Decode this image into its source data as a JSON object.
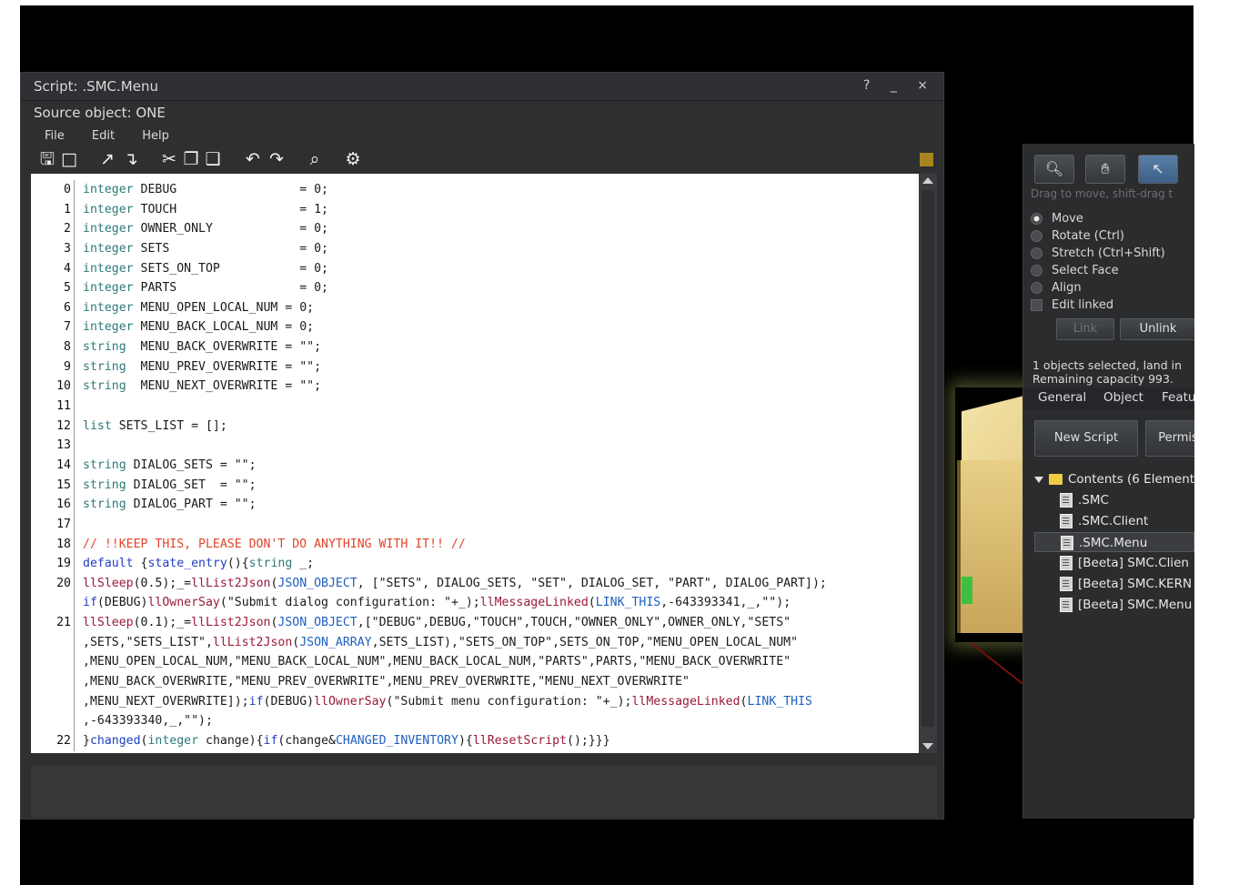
{
  "script_window": {
    "title": "Script: .SMC.Menu",
    "controls": "? _ ×",
    "source_object": "Source object: ONE",
    "menu": [
      "File",
      "Edit",
      "Help"
    ],
    "toolbar_icons": [
      "save-icon",
      "save-as-icon",
      "load-icon",
      "save-to-disk-icon",
      "cut-icon",
      "copy-icon",
      "paste-icon",
      "undo-icon",
      "redo-icon",
      "find-icon",
      "settings-icon"
    ]
  },
  "code_lines": [
    {
      "n": "0",
      "segs": [
        [
          "integer",
          "type"
        ],
        [
          " DEBUG                 = 0;",
          ""
        ]
      ]
    },
    {
      "n": "1",
      "segs": [
        [
          "integer",
          "type"
        ],
        [
          " TOUCH                 = 1;",
          ""
        ]
      ]
    },
    {
      "n": "2",
      "segs": [
        [
          "integer",
          "type"
        ],
        [
          " OWNER_ONLY            = 0;",
          ""
        ]
      ]
    },
    {
      "n": "3",
      "segs": [
        [
          "integer",
          "type"
        ],
        [
          " SETS                  = 0;",
          ""
        ]
      ]
    },
    {
      "n": "4",
      "segs": [
        [
          "integer",
          "type"
        ],
        [
          " SETS_ON_TOP           = 0;",
          ""
        ]
      ]
    },
    {
      "n": "5",
      "segs": [
        [
          "integer",
          "type"
        ],
        [
          " PARTS                 = 0;",
          ""
        ]
      ]
    },
    {
      "n": "6",
      "segs": [
        [
          "integer",
          "type"
        ],
        [
          " MENU_OPEN_LOCAL_NUM = 0;",
          ""
        ]
      ]
    },
    {
      "n": "7",
      "segs": [
        [
          "integer",
          "type"
        ],
        [
          " MENU_BACK_LOCAL_NUM = 0;",
          ""
        ]
      ]
    },
    {
      "n": "8",
      "segs": [
        [
          "string",
          "type"
        ],
        [
          "  MENU_BACK_OVERWRITE = \"\";",
          ""
        ]
      ]
    },
    {
      "n": "9",
      "segs": [
        [
          "string",
          "type"
        ],
        [
          "  MENU_PREV_OVERWRITE = \"\";",
          ""
        ]
      ]
    },
    {
      "n": "10",
      "segs": [
        [
          "string",
          "type"
        ],
        [
          "  MENU_NEXT_OVERWRITE = \"\";",
          ""
        ]
      ]
    },
    {
      "n": "11",
      "segs": []
    },
    {
      "n": "12",
      "segs": [
        [
          "list",
          "type"
        ],
        [
          " SETS_LIST = [];",
          ""
        ]
      ]
    },
    {
      "n": "13",
      "segs": []
    },
    {
      "n": "14",
      "segs": [
        [
          "string",
          "type"
        ],
        [
          " DIALOG_SETS = \"\";",
          ""
        ]
      ]
    },
    {
      "n": "15",
      "segs": [
        [
          "string",
          "type"
        ],
        [
          " DIALOG_SET  = \"\";",
          ""
        ]
      ]
    },
    {
      "n": "16",
      "segs": [
        [
          "string",
          "type"
        ],
        [
          " DIALOG_PART = \"\";",
          ""
        ]
      ]
    },
    {
      "n": "17",
      "segs": []
    },
    {
      "n": "18",
      "segs": [
        [
          "// !!KEEP THIS, PLEASE DON'T DO ANYTHING WITH IT!! //",
          "cmt"
        ]
      ]
    },
    {
      "n": "19",
      "segs": [
        [
          "default",
          "kw"
        ],
        [
          " {",
          ""
        ],
        [
          "state_entry",
          "kw"
        ],
        [
          "(){",
          ""
        ],
        [
          "string",
          "type"
        ],
        [
          " _;",
          ""
        ]
      ]
    },
    {
      "n": "20",
      "segs": [
        [
          "llSleep",
          "fn"
        ],
        [
          "(0.5);_=",
          ""
        ],
        [
          "llList2Json",
          "fn"
        ],
        [
          "(",
          ""
        ],
        [
          "JSON_OBJECT",
          "const"
        ],
        [
          ", [\"SETS\", DIALOG_SETS, \"SET\", DIALOG_SET, \"PART\", DIALOG_PART]);",
          ""
        ]
      ]
    },
    {
      "n": "",
      "segs": [
        [
          "if",
          "kw"
        ],
        [
          "(DEBUG)",
          ""
        ],
        [
          "llOwnerSay",
          "fn"
        ],
        [
          "(\"Submit dialog configuration: \"+_);",
          ""
        ],
        [
          "llMessageLinked",
          "fn"
        ],
        [
          "(",
          ""
        ],
        [
          "LINK_THIS",
          "const"
        ],
        [
          ",-643393341,_,\"\");",
          ""
        ]
      ]
    },
    {
      "n": "21",
      "segs": [
        [
          "llSleep",
          "fn"
        ],
        [
          "(0.1);_=",
          ""
        ],
        [
          "llList2Json",
          "fn"
        ],
        [
          "(",
          ""
        ],
        [
          "JSON_OBJECT",
          "const"
        ],
        [
          ",[\"DEBUG\",DEBUG,\"TOUCH\",TOUCH,\"OWNER_ONLY\",OWNER_ONLY,\"SETS\"",
          ""
        ]
      ]
    },
    {
      "n": "",
      "segs": [
        [
          ",SETS,\"SETS_LIST\",",
          ""
        ],
        [
          "llList2Json",
          "fn"
        ],
        [
          "(",
          ""
        ],
        [
          "JSON_ARRAY",
          "const"
        ],
        [
          ",SETS_LIST),\"SETS_ON_TOP\",SETS_ON_TOP,\"MENU_OPEN_LOCAL_NUM\"",
          ""
        ]
      ]
    },
    {
      "n": "",
      "segs": [
        [
          ",MENU_OPEN_LOCAL_NUM,\"MENU_BACK_LOCAL_NUM\",MENU_BACK_LOCAL_NUM,\"PARTS\",PARTS,\"MENU_BACK_OVERWRITE\"",
          ""
        ]
      ]
    },
    {
      "n": "",
      "segs": [
        [
          ",MENU_BACK_OVERWRITE,\"MENU_PREV_OVERWRITE\",MENU_PREV_OVERWRITE,\"MENU_NEXT_OVERWRITE\"",
          ""
        ]
      ]
    },
    {
      "n": "",
      "segs": [
        [
          ",MENU_NEXT_OVERWRITE]);",
          ""
        ],
        [
          "if",
          "kw"
        ],
        [
          "(DEBUG)",
          ""
        ],
        [
          "llOwnerSay",
          "fn"
        ],
        [
          "(\"Submit menu configuration: \"+_);",
          ""
        ],
        [
          "llMessageLinked",
          "fn"
        ],
        [
          "(",
          ""
        ],
        [
          "LINK_THIS",
          "const"
        ]
      ]
    },
    {
      "n": "",
      "segs": [
        [
          ",-643393340,_,\"\");",
          ""
        ]
      ]
    },
    {
      "n": "22",
      "segs": [
        [
          "}",
          ""
        ],
        [
          "changed",
          "kw"
        ],
        [
          "(",
          ""
        ],
        [
          "integer",
          "type"
        ],
        [
          " change){",
          ""
        ],
        [
          "if",
          "kw"
        ],
        [
          "(change&",
          ""
        ],
        [
          "CHANGED_INVENTORY",
          "const"
        ],
        [
          "){",
          ""
        ],
        [
          "llResetScript",
          "fn"
        ],
        [
          "();}}}",
          ""
        ]
      ]
    }
  ],
  "build_panel": {
    "tool_icons": [
      "magnifier-icon",
      "hand-icon",
      "pointer-icon"
    ],
    "hint": "Drag to move, shift-drag t",
    "modes": [
      {
        "label": "Move",
        "selected": true
      },
      {
        "label": "Rotate (Ctrl)",
        "selected": false
      },
      {
        "label": "Stretch (Ctrl+Shift)",
        "selected": false
      },
      {
        "label": "Select Face",
        "selected": false
      },
      {
        "label": "Align",
        "selected": false
      }
    ],
    "edit_linked": "Edit linked",
    "link_label": "Link",
    "unlink_label": "Unlink",
    "selection_line1": "1 objects selected, land in",
    "selection_line2": "Remaining capacity 993.",
    "tabs": [
      "General",
      "Object",
      "Featu"
    ],
    "new_script": "New Script",
    "permissions": "Permis",
    "contents_header": "Contents (6 Element",
    "items": [
      ".SMC",
      ".SMC.Client",
      ".SMC.Menu",
      "[Beeta] SMC.Clien",
      "[Beeta] SMC.KERN",
      "[Beeta] SMC.Menu"
    ],
    "selected_item": ".SMC.Menu"
  },
  "colors": {
    "accent": "#a8861e",
    "window": "#2e2f31",
    "comment": "#e0452a",
    "keyword": "#1f3fbf",
    "function": "#9a1b3a"
  }
}
